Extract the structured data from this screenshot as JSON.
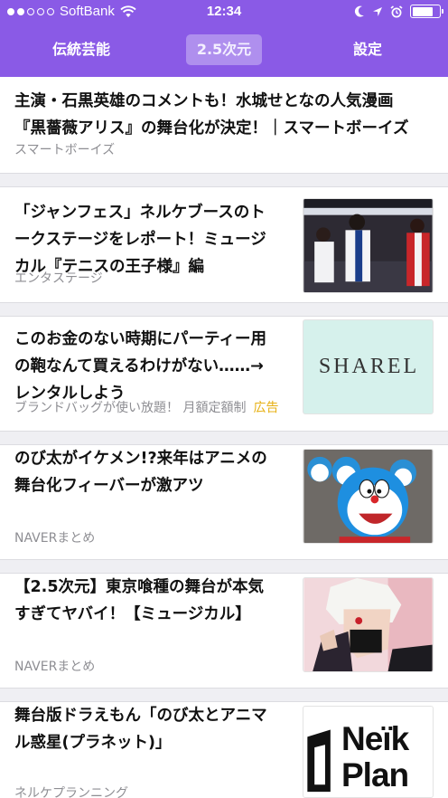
{
  "status_bar": {
    "carrier": "SoftBank",
    "time": "12:34"
  },
  "tabs": [
    {
      "label": "伝統芸能"
    },
    {
      "label": "2.5次元",
      "selected": true
    },
    {
      "label": "設定"
    }
  ],
  "articles": [
    {
      "title_lines": [
        "主演・石黒英雄のコメントも！水城せとなの人気漫画",
        "『黒薔薇アリス』の舞台化が決定！｜スマートボーイズ"
      ],
      "source": "スマートボーイズ"
    },
    {
      "title_lines": [
        "「ジャンフェス」ネルケブースのト",
        "ークステージをレポート！ミュージ",
        "カル『テニスの王子様』編"
      ],
      "source": "エンタステージ",
      "thumbnail": "stage-photo"
    },
    {
      "title_lines": [
        "このお金のない時期にパーティー用",
        "の鞄なんて買えるわけがない……→",
        "レンタルしよう"
      ],
      "source": "ブランドバッグが使い放題！ 月額定額制",
      "ad_label": "広告",
      "thumbnail_text": "SHAREL"
    },
    {
      "title_lines": [
        "のび太がイケメン!?来年はアニメの",
        "舞台化フィーバーが激アツ"
      ],
      "source": "NAVERまとめ",
      "thumbnail": "doraemon-figures"
    },
    {
      "title_lines": [
        "【2.5次元】東京喰種の舞台が本気",
        "すぎてヤバイ！【ミュージカル】"
      ],
      "source": "NAVERまとめ",
      "thumbnail": "tokyo-ghoul-illustration"
    },
    {
      "title_lines": [
        "舞台版ドラえもん「のび太とアニマ",
        "ル惑星(プラネット)」"
      ],
      "source": "ネルケプランニング",
      "thumbnail_text_lines": [
        "Neïk",
        "Plan"
      ]
    }
  ],
  "colors": {
    "header": "#8a5ae6",
    "ad": "#e7b116",
    "source": "#8e8e93",
    "separator": "#efeff3"
  }
}
